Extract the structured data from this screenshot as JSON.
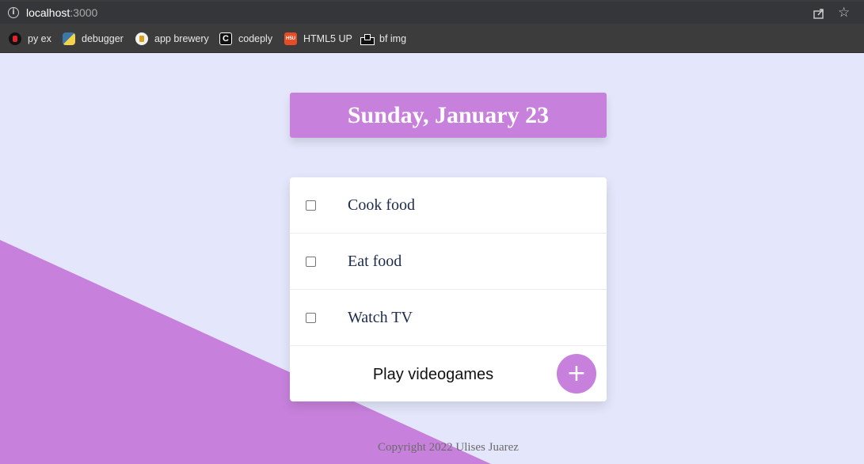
{
  "browser": {
    "url_host": "localhost",
    "url_port": ":3000",
    "info_icon": "info-icon",
    "share_icon": "share-icon",
    "star_icon": "star-icon",
    "bookmarks": [
      {
        "label": "py ex",
        "icon": "py-ex-favicon"
      },
      {
        "label": "debugger",
        "icon": "python-favicon"
      },
      {
        "label": "app brewery",
        "icon": "app-brewery-favicon"
      },
      {
        "label": "codeply",
        "icon": "codeply-favicon"
      },
      {
        "label": "HTML5 UP",
        "icon": "html5up-favicon"
      },
      {
        "label": "bf img",
        "icon": "bf-img-favicon"
      }
    ]
  },
  "app": {
    "heading": "Sunday, January 23",
    "items": [
      {
        "text": "Cook food",
        "checked": false
      },
      {
        "text": "Eat food",
        "checked": false
      },
      {
        "text": "Watch TV",
        "checked": false
      }
    ],
    "new_item_value": "Play videogames",
    "add_button_label": "+",
    "footer": "Copyright 2022 Ulises Juarez"
  },
  "colors": {
    "background": "#e4e6fb",
    "accent": "#c781dc",
    "card": "#ffffff",
    "item_text": "#1d2b4d"
  }
}
